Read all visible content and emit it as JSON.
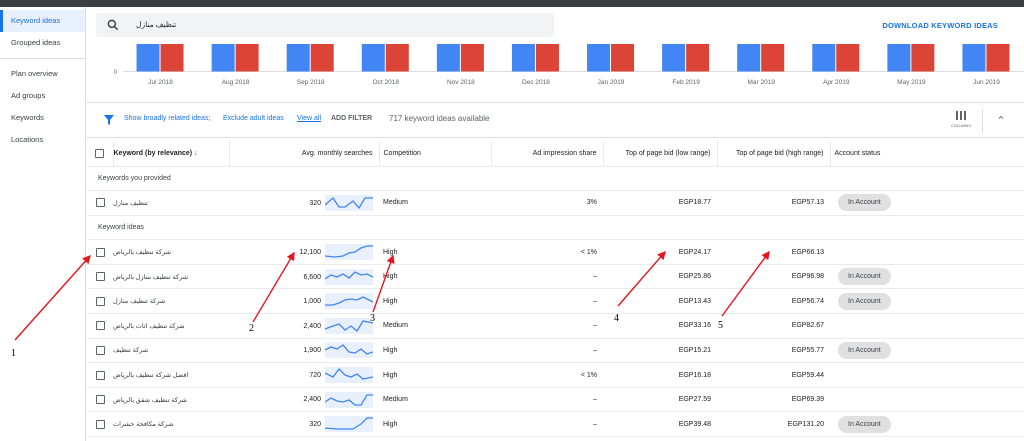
{
  "sidebar": {
    "items": [
      {
        "label": "Keyword ideas",
        "active": true
      },
      {
        "label": "Grouped ideas",
        "active": false
      },
      {
        "label": "Plan overview",
        "active": false
      },
      {
        "label": "Ad groups",
        "active": false
      },
      {
        "label": "Keywords",
        "active": false
      },
      {
        "label": "Locations",
        "active": false
      }
    ]
  },
  "header": {
    "search_value": "تنظيف منازل",
    "download_label": "DOWNLOAD KEYWORD IDEAS"
  },
  "chart_data": {
    "type": "bar",
    "categories": [
      "Jul 2018",
      "Aug 2018",
      "Sep 2018",
      "Oct 2018",
      "Nov 2018",
      "Dec 2018",
      "Jan 2019",
      "Feb 2019",
      "Mar 2019",
      "Apr 2019",
      "May 2019",
      "Jun 2019"
    ],
    "y_tick": "0",
    "series": [
      {
        "color": "#4285f4"
      },
      {
        "color": "#db4437"
      }
    ]
  },
  "filter": {
    "broad_label": "Show broadly related ideas;",
    "adult_label": "Exclude adult ideas",
    "view_all": "View all",
    "add_filter": "ADD FILTER",
    "count": "717 keyword ideas available",
    "columns_label": "COLUMNS"
  },
  "table": {
    "headers": {
      "keyword": "Keyword (by relevance)",
      "searches": "Avg. monthly searches",
      "competition": "Competition",
      "impression": "Ad impression share",
      "bid_low": "Top of page bid (low range)",
      "bid_high": "Top of page bid (high range)",
      "status": "Account status"
    },
    "section_provided": "Keywords you provided",
    "provided_rows": [
      {
        "keyword": "تنظيف منازل",
        "searches": "320",
        "competition": "Medium",
        "impression": "3%",
        "bid_low": "EGP18.77",
        "bid_high": "EGP57.13",
        "status": "In Account"
      }
    ],
    "section_ideas": "Keyword ideas",
    "idea_rows": [
      {
        "keyword": "شركة تنظيف بالرياض",
        "searches": "12,100",
        "competition": "High",
        "impression": "< 1%",
        "bid_low": "EGP24.17",
        "bid_high": "EGP66.13",
        "status": ""
      },
      {
        "keyword": "شركة تنظيف منازل بالرياض",
        "searches": "6,600",
        "competition": "High",
        "impression": "–",
        "bid_low": "EGP25.86",
        "bid_high": "EGP96.98",
        "status": "In Account"
      },
      {
        "keyword": "شركة تنظيف منازل",
        "searches": "1,000",
        "competition": "High",
        "impression": "–",
        "bid_low": "EGP13.43",
        "bid_high": "EGP56.74",
        "status": "In Account"
      },
      {
        "keyword": "شركة تنظيف اثاث بالرياض",
        "searches": "2,400",
        "competition": "Medium",
        "impression": "–",
        "bid_low": "EGP33.16",
        "bid_high": "EGP82.67",
        "status": ""
      },
      {
        "keyword": "شركة تنظيف",
        "searches": "1,900",
        "competition": "High",
        "impression": "–",
        "bid_low": "EGP15.21",
        "bid_high": "EGP55.77",
        "status": "In Account"
      },
      {
        "keyword": "افضل شركة تنظيف بالرياض",
        "searches": "720",
        "competition": "High",
        "impression": "< 1%",
        "bid_low": "EGP16.18",
        "bid_high": "EGP59.44",
        "status": ""
      },
      {
        "keyword": "شركة تنظيف شقق بالرياض",
        "searches": "2,400",
        "competition": "Medium",
        "impression": "–",
        "bid_low": "EGP27.59",
        "bid_high": "EGP69.39",
        "status": ""
      },
      {
        "keyword": "شركة مكافحة حشرات",
        "searches": "320",
        "competition": "High",
        "impression": "–",
        "bid_low": "EGP39.48",
        "bid_high": "EGP131.20",
        "status": "In Account"
      }
    ]
  },
  "annotations": {
    "labels": [
      "1",
      "2",
      "3",
      "4",
      "5"
    ],
    "arrow_color": "#e8141c"
  }
}
